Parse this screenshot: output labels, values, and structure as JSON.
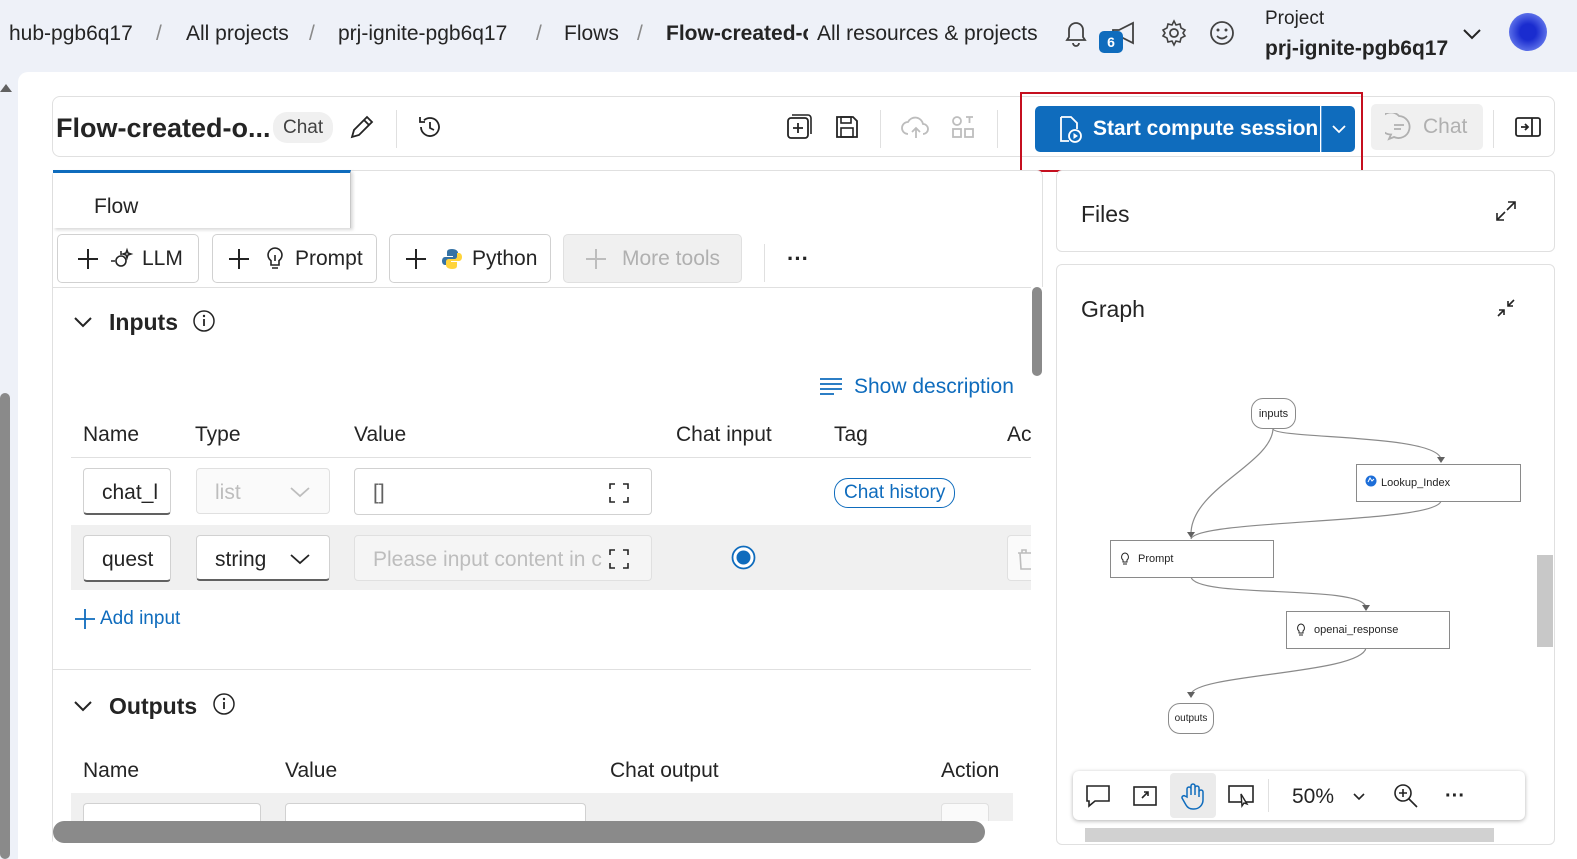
{
  "breadcrumb": {
    "items": [
      "hub-pgb6q17",
      "All projects",
      "prj-ignite-pgb6q17",
      "Flows",
      "Flow-created-o"
    ],
    "separator": "/",
    "scope_label": "All resources & projects"
  },
  "header": {
    "notification_count": "6",
    "project_label": "Project",
    "project_name": "prj-ignite-pgb6q17"
  },
  "flow": {
    "title": "Flow-created-o...",
    "type_badge": "Chat",
    "compute_button": "Start compute session",
    "chat_button": "Chat",
    "tab_label": "Flow"
  },
  "toolbar": {
    "llm": "LLM",
    "prompt": "Prompt",
    "python": "Python",
    "more_tools": "More tools",
    "more_label": "···"
  },
  "inputs": {
    "title": "Inputs",
    "show_description": "Show description",
    "columns": [
      "Name",
      "Type",
      "Value",
      "Chat input",
      "Tag",
      "Ac"
    ],
    "rows": [
      {
        "name": "chat_l",
        "type": "list",
        "value": "[]",
        "tag": "Chat history",
        "chat_input": false
      },
      {
        "name": "quest",
        "type": "string",
        "value_placeholder": "Please input content in c",
        "chat_input": true
      }
    ],
    "add_input": "Add input"
  },
  "outputs": {
    "title": "Outputs",
    "columns": [
      "Name",
      "Value",
      "Chat output",
      "Action"
    ]
  },
  "files": {
    "title": "Files"
  },
  "graph": {
    "title": "Graph",
    "nodes": {
      "inputs": "inputs",
      "lookup": "Lookup_Index",
      "prompt": "Prompt",
      "openai": "openai_response",
      "outputs": "outputs"
    },
    "zoom": "50%"
  },
  "colors": {
    "accent": "#0f6cbd",
    "highlight": "#c50f1f"
  }
}
